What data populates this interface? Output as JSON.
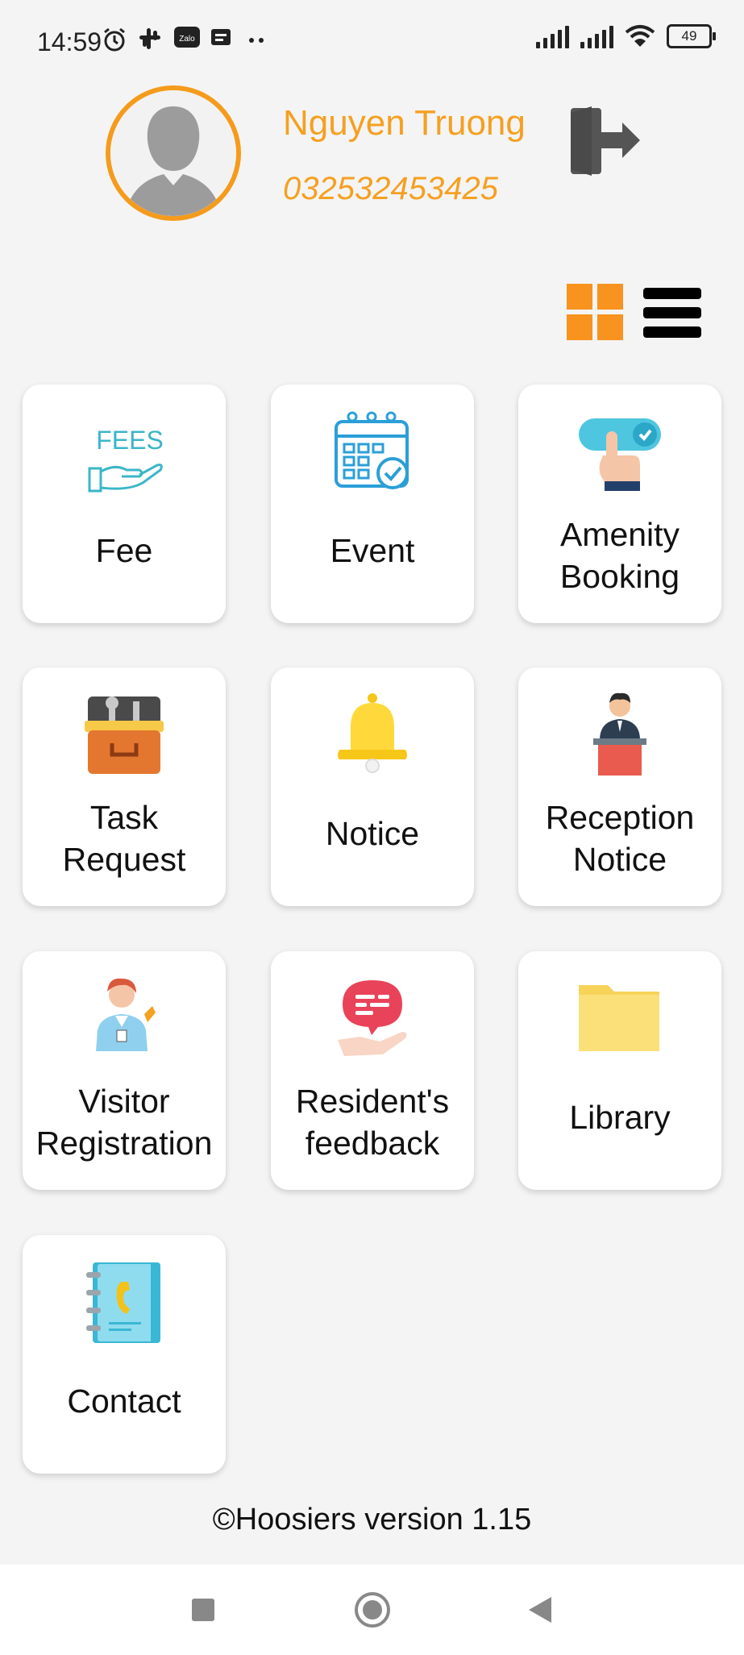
{
  "status_bar": {
    "time": "14:59",
    "battery": "49",
    "icons": [
      "alarm-icon",
      "slack-icon",
      "zalo-icon",
      "message-icon",
      "more-dots-icon",
      "signal-icon",
      "wifi-icon",
      "battery-icon"
    ]
  },
  "profile": {
    "name": "Nguyen Truong",
    "phone": "032532453425"
  },
  "colors": {
    "accent": "#f5a022",
    "grid_toggle": "#f7931e",
    "background": "#f4f4f4"
  },
  "menu": {
    "fee": "Fee",
    "event": "Event",
    "amenity": [
      "Amenity",
      "Booking"
    ],
    "task": [
      "Task",
      "Request"
    ],
    "notice": "Notice",
    "reception": [
      "Reception",
      "Notice"
    ],
    "visitor": [
      "Visitor",
      "Registration"
    ],
    "feedback": [
      "Resident's",
      "feedback"
    ],
    "library": "Library",
    "contact": "Contact",
    "fees_icon_text": "FEES"
  },
  "footer": {
    "version": "©Hoosiers version 1.15"
  }
}
